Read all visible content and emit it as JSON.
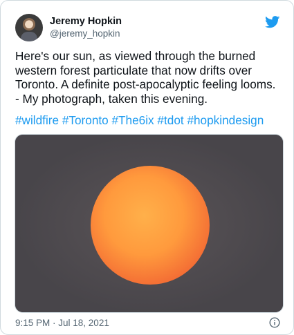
{
  "tweet": {
    "author": {
      "display_name": "Jeremy Hopkin",
      "handle": "@jeremy_hopkin"
    },
    "text": "Here's our sun, as viewed through the burned western forest particulate that now drifts over Toronto. A definite post-apocalyptic feeling looms. - My photograph, taken this evening.",
    "hashtags": [
      "#wildfire",
      "#Toronto",
      "#The6ix",
      "#tdot",
      "#hopkindesign"
    ],
    "timestamp": "9:15 PM · Jul 18, 2021"
  },
  "icons": {
    "brand": "twitter-bird-icon",
    "info": "info-icon"
  },
  "colors": {
    "link": "#1d9bf0",
    "text": "#0f1419",
    "muted": "#536471",
    "sky": "#4d4a4f",
    "sun_core": "#ffa23f",
    "sun_edge": "#f47a38"
  }
}
